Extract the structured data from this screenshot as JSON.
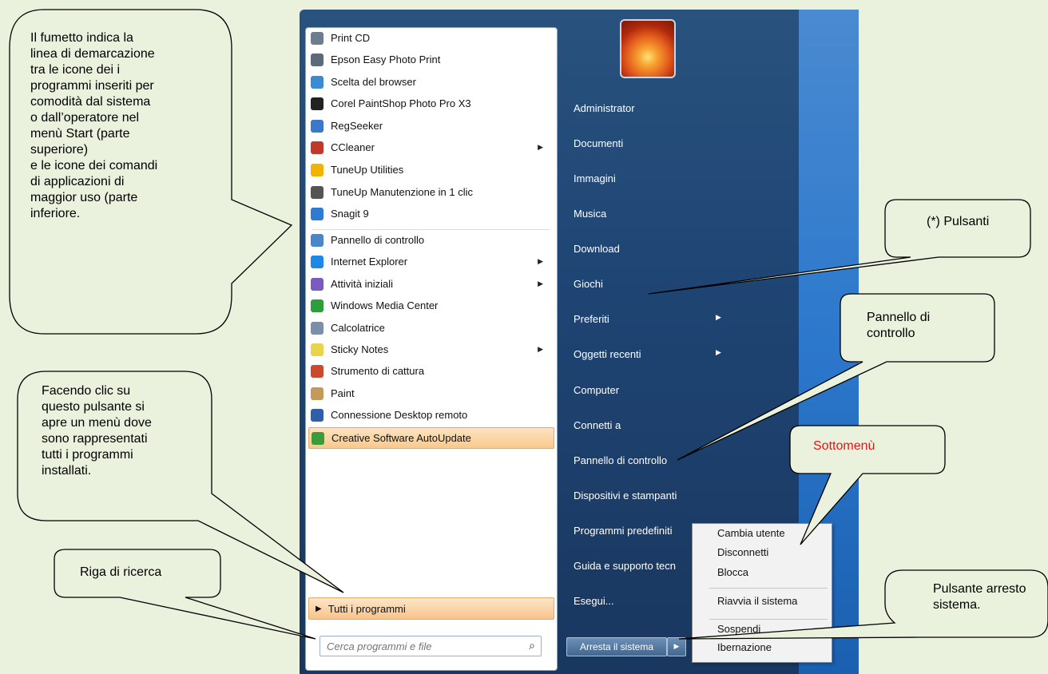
{
  "colors": {
    "menu_bg": "#1f4574",
    "highlight": "#f9c98c",
    "submenu_title": "#e81414",
    "background": "#eaf1dd"
  },
  "programs": [
    {
      "label": "Print CD",
      "icon": "cd-icon",
      "color": "#6d7c8f",
      "arrow": false
    },
    {
      "label": "Epson Easy Photo Print",
      "icon": "printer-icon",
      "color": "#5b6b7b",
      "arrow": false
    },
    {
      "label": "Scelta del browser",
      "icon": "checkbox-icon",
      "color": "#3a8bd1",
      "arrow": false
    },
    {
      "label": "Corel PaintShop Photo Pro X3",
      "icon": "camera-icon",
      "color": "#222222",
      "arrow": false
    },
    {
      "label": "RegSeeker",
      "icon": "registry-icon",
      "color": "#3c78c8",
      "arrow": false
    },
    {
      "label": "CCleaner",
      "icon": "ccleaner-icon",
      "color": "#c0392b",
      "arrow": true
    },
    {
      "label": "TuneUp Utilities",
      "icon": "tuneup-icon",
      "color": "#f0b400",
      "arrow": false
    },
    {
      "label": "TuneUp Manutenzione in 1 clic",
      "icon": "calendar-icon",
      "color": "#555555",
      "arrow": false
    },
    {
      "label": "Snagit 9",
      "icon": "snagit-icon",
      "color": "#2f7bd1",
      "arrow": false
    },
    {
      "label": "Pannello di controllo",
      "icon": "control-panel-icon",
      "color": "#4a87c9",
      "arrow": false
    },
    {
      "label": "Internet Explorer",
      "icon": "internet-explorer-icon",
      "color": "#1e88e5",
      "arrow": true
    },
    {
      "label": "Attività iniziali",
      "icon": "getting-started-icon",
      "color": "#7a5cbf",
      "arrow": true
    },
    {
      "label": "Windows Media Center",
      "icon": "media-center-icon",
      "color": "#2e9e3c",
      "arrow": false
    },
    {
      "label": "Calcolatrice",
      "icon": "calculator-icon",
      "color": "#7a8fa8",
      "arrow": false
    },
    {
      "label": "Sticky Notes",
      "icon": "sticky-notes-icon",
      "color": "#e9d44a",
      "arrow": true
    },
    {
      "label": "Strumento di cattura",
      "icon": "scissors-icon",
      "color": "#c94a2e",
      "arrow": false
    },
    {
      "label": "Paint",
      "icon": "paint-icon",
      "color": "#c49a5a",
      "arrow": false
    },
    {
      "label": "Connessione Desktop remoto",
      "icon": "remote-desktop-icon",
      "color": "#2f5fa8",
      "arrow": false
    },
    {
      "label": "Creative Software AutoUpdate",
      "icon": "autoupdate-icon",
      "color": "#3a9b3a",
      "arrow": false,
      "highlight": true
    }
  ],
  "all_programs_label": "Tutti i programmi",
  "search_placeholder": "Cerca programmi e file",
  "right_items": [
    {
      "label": "Administrator",
      "arrow": false
    },
    {
      "label": "Documenti",
      "arrow": false
    },
    {
      "label": "Immagini",
      "arrow": false
    },
    {
      "label": "Musica",
      "arrow": false
    },
    {
      "label": "Download",
      "arrow": false
    },
    {
      "label": "Giochi",
      "arrow": false
    },
    {
      "label": "Preferiti",
      "arrow": true
    },
    {
      "label": "Oggetti recenti",
      "arrow": true
    },
    {
      "label": "Computer",
      "arrow": false
    },
    {
      "label": "Connetti a",
      "arrow": false
    },
    {
      "label": "Pannello di controllo",
      "arrow": false
    },
    {
      "label": "Dispositivi e stampanti",
      "arrow": false
    },
    {
      "label": "Programmi predefiniti",
      "arrow": false
    },
    {
      "label": "Guida e supporto tecn",
      "arrow": false
    },
    {
      "label": "Esegui...",
      "arrow": false
    }
  ],
  "shutdown_label": "Arresta il sistema",
  "submenu": [
    "Cambia utente",
    "Disconnetti",
    "Blocca",
    "Riavvia il sistema",
    "Sospendi",
    "Ibernazione"
  ],
  "callouts": {
    "demarcation": "Il fumetto indica la\nlinea di demarcazione\ntra le icone dei i\nprogrammi inseriti per\ncomodità dal sistema\no dall’operatore nel\nmenù Start (parte\nsuperiore)\ne le icone dei comandi\ndi applicazioni di\nmaggior uso (parte\ninferiore.",
    "all_programs": "Facendo clic su\nquesto pulsante si\napre un menù dove\nsono rappresentati\ntutti i programmi\ninstallati.",
    "search": "Riga di ricerca",
    "buttons": "(*) Pulsanti",
    "control_panel": "Pannello di\ncontrollo",
    "submenu": "Sottomenù",
    "shutdown": "Pulsante arresto\nsistema."
  }
}
